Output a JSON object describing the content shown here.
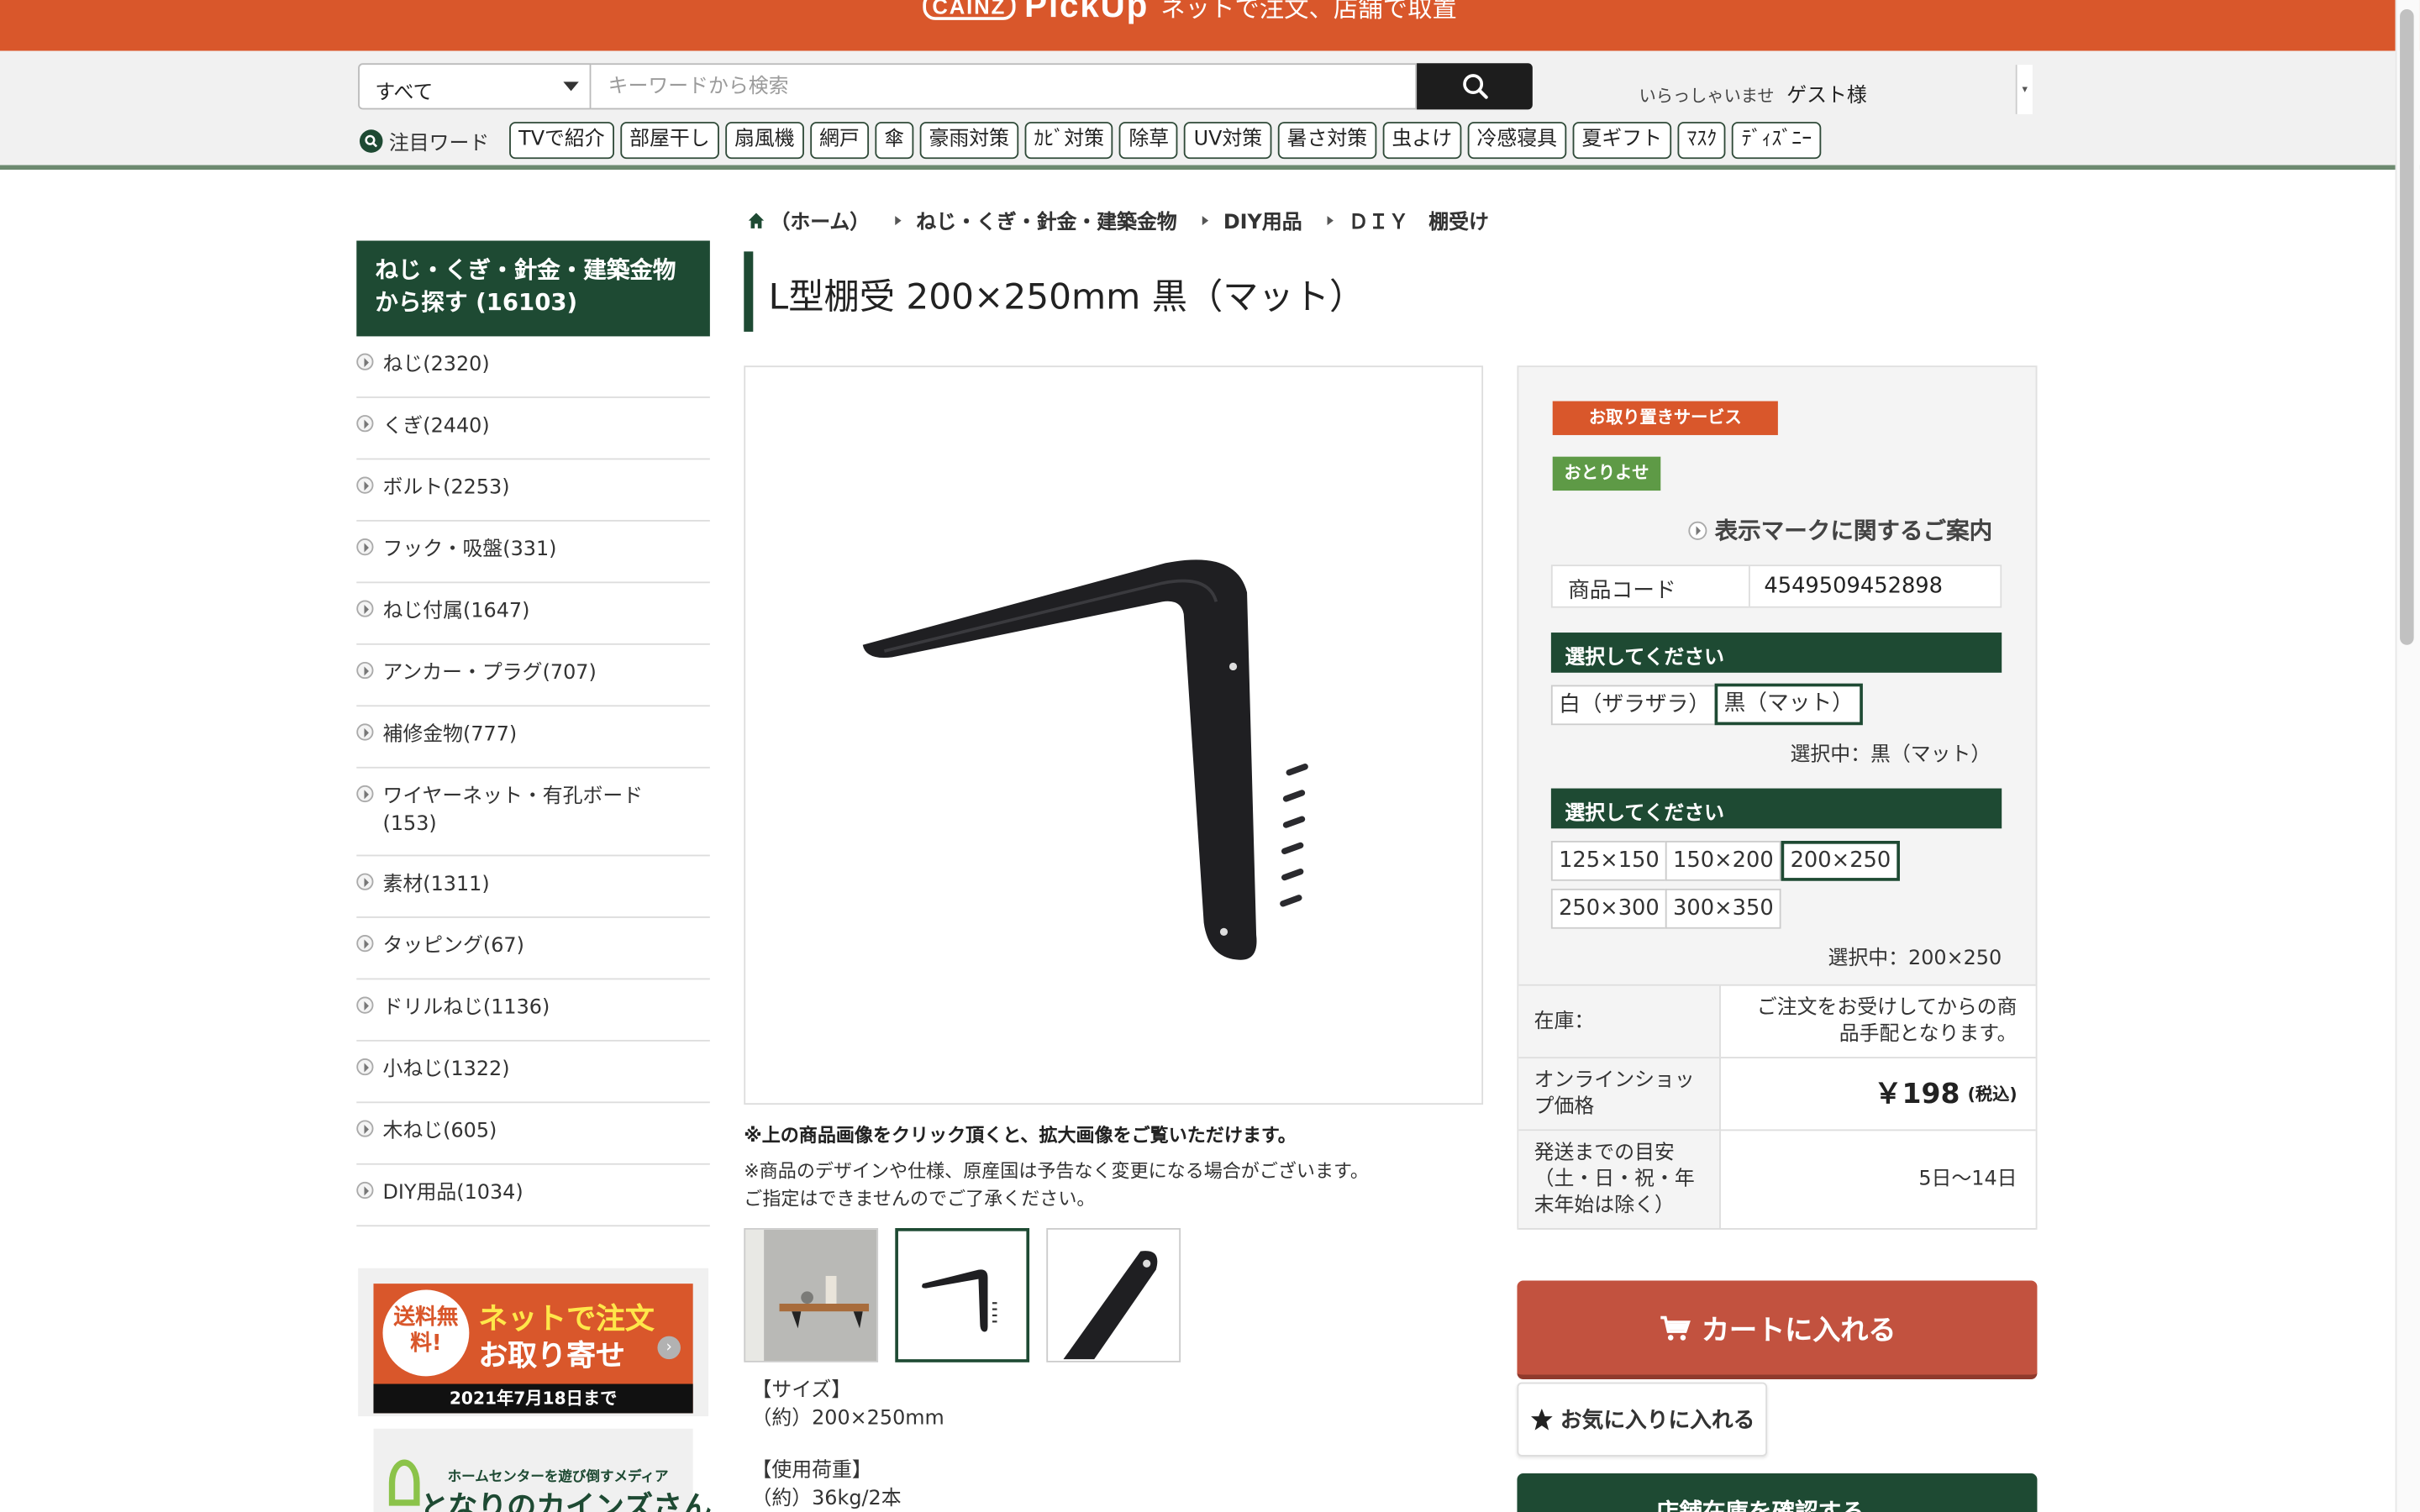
{
  "banner": {
    "logo_small": "CAINZ",
    "logo_main": "PickUp",
    "text": "ネットで注文、店舗で取置"
  },
  "header": {
    "category_select": "すべて",
    "search_placeholder": "キーワードから検索",
    "greeting": "いらっしゃいませ",
    "guest": "ゲスト様",
    "hot_label": "注目ワード",
    "hot_words": [
      "TVで紹介",
      "部屋干し",
      "扇風機",
      "網戸",
      "傘",
      "豪雨対策",
      "ｶﾋﾞ対策",
      "除草",
      "UV対策",
      "暑さ対策",
      "虫よけ",
      "冷感寝具",
      "夏ギフト",
      "ﾏｽｸ",
      "ﾃﾞｨｽﾞﾆｰ"
    ]
  },
  "breadcrumb": [
    "（ホーム）",
    "ねじ・くぎ・針金・建築金物",
    "DIY用品",
    "ＤＩＹ　棚受け"
  ],
  "product": {
    "title": "L型棚受 200×250mm 黒（マット）",
    "image_note": "※上の商品画像をクリック頂くと、拡大画像をご覧いただけます。",
    "disclaimer_1": "※商品のデザインや仕様、原産国は予告なく変更になる場合がございます。",
    "disclaimer_2": "ご指定はできませんのでご了承ください。",
    "spec_size_label": "【サイズ】",
    "spec_size_value": "（約）200×250mm",
    "spec_load_label": "【使用荷重】",
    "spec_load_value": "（約）36kg/2本"
  },
  "sidebar": {
    "heading": "ねじ・くぎ・針金・建築金物から探す (16103)",
    "items": [
      {
        "label": "ねじ(2320)"
      },
      {
        "label": "くぎ(2440)"
      },
      {
        "label": "ボルト(2253)"
      },
      {
        "label": "フック・吸盤(331)"
      },
      {
        "label": "ねじ付属(1647)"
      },
      {
        "label": "アンカー・プラグ(707)"
      },
      {
        "label": "補修金物(777)"
      },
      {
        "label": "ワイヤーネット・有孔ボード(153)"
      },
      {
        "label": "素材(1311)"
      },
      {
        "label": "タッピング(67)"
      },
      {
        "label": "ドリルねじ(1136)"
      },
      {
        "label": "小ねじ(1322)"
      },
      {
        "label": "木ねじ(605)"
      },
      {
        "label": "DIY用品(1034)"
      }
    ],
    "promo1": {
      "badge": "送料無料!",
      "line1": "ネットで注文",
      "line2": "お取り寄せ",
      "date": "2021年7月18日まで"
    },
    "promo2": {
      "small": "ホームセンターを遊び倒すメディア",
      "big": "となりのカインズさん"
    }
  },
  "panel": {
    "tag_service": "お取り置きサービス",
    "tag_order": "おとりよせ",
    "mark_guide": "表示マークに関するご案内",
    "code_label": "商品コード",
    "code_value": "4549509452898",
    "select_heading": "選択してください",
    "color_options": [
      "白（ザラザラ）",
      "黒（マット）"
    ],
    "color_selected": "選択中：黒（マット）",
    "size_options": [
      "125×150",
      "150×200",
      "200×250",
      "250×300",
      "300×350"
    ],
    "size_selected": "選択中：200×250",
    "stock_label": "在庫：",
    "stock_value": "ご注文をお受けしてからの商品手配となります。",
    "price_label": "オンラインショップ価格",
    "price_value": "￥198",
    "price_tax": "(税込)",
    "ship_label": "発送までの目安（土・日・祝・年末年始は除く）",
    "ship_value": "5日〜14日",
    "cart_button": "カートに入れる",
    "fav_button": "お気に入りに入れる",
    "store_button": "店舗在庫を確認する"
  },
  "colors": {
    "brand_orange": "#d9572b",
    "brand_green": "#1e4a33",
    "cart_red": "#c2523f",
    "order_green": "#5e9a46"
  }
}
